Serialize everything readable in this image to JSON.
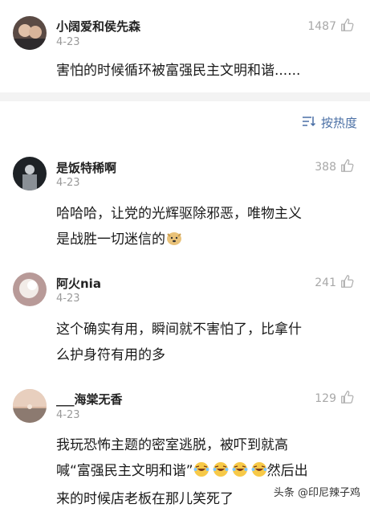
{
  "comments": [
    {
      "user": "小阔爱和侯先森",
      "date": "4-23",
      "likes": "1487",
      "text": "害怕的时候循环被富强民主文明和谐......"
    },
    {
      "user": "是饭特稀啊",
      "date": "4-23",
      "likes": "388",
      "text_l1": "哈哈哈，让党的光辉驱除邪恶，唯物主义",
      "text_l2": "是战胜一切迷信的"
    },
    {
      "user": "阿火nia",
      "date": "4-23",
      "likes": "241",
      "text_l1": "这个确实有用，瞬间就不害怕了，比拿什",
      "text_l2": "么护身符有用的多"
    },
    {
      "user": "___海棠无香",
      "date": "4-23",
      "likes": "129",
      "text_l1": "我玩恐怖主题的密室逃脱，被吓到就高",
      "text_l2a": "喊“富强民主文明和谐”",
      "text_l2b": "然后出",
      "text_l3": "来的时候店老板在那儿笑死了"
    }
  ],
  "sort": {
    "label": "按热度"
  },
  "watermark": "头条 @印尼辣子鸡",
  "icons": {
    "like": "thumbs-up-icon",
    "sort": "sort-icon"
  }
}
